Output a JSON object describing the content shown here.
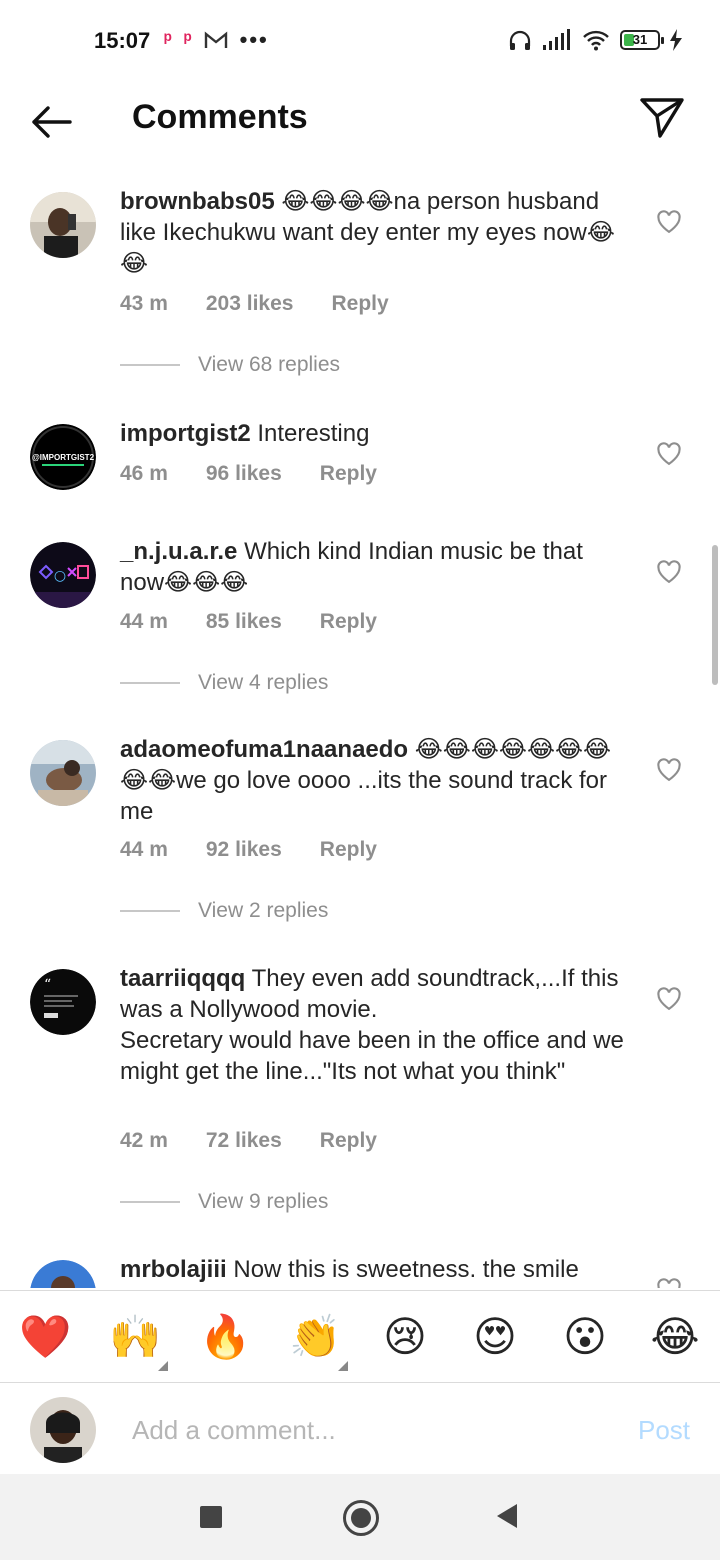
{
  "status": {
    "time": "15:07",
    "left_icons": [
      "p-app-icon",
      "p-app-icon",
      "gmail-icon",
      "more-dots-icon"
    ],
    "battery": "31",
    "battery_level_percent": 31,
    "right_icons": [
      "headphones-icon",
      "signal-icon",
      "wifi-icon",
      "battery-icon",
      "charging-icon"
    ]
  },
  "header": {
    "title": "Comments",
    "back_icon": "arrow-left-icon",
    "send_icon": "paper-plane-icon"
  },
  "comments": [
    {
      "username": "brownbabs05",
      "text": "😂😂😂😂na person husband like Ikechukwu want dey enter my eyes now😂😂",
      "time": "43 m",
      "likes": "203 likes",
      "reply": "Reply",
      "view_replies": "View 68 replies"
    },
    {
      "username": "importgist2",
      "text": "Interesting",
      "time": "46 m",
      "likes": "96 likes",
      "reply": "Reply",
      "avatar_text": "@IMPORTGIST2"
    },
    {
      "username": "_n.j.u.a.r.e",
      "text": "Which kind Indian music be that now😂😂😂",
      "time": "44 m",
      "likes": "85 likes",
      "reply": "Reply",
      "view_replies": "View 4 replies"
    },
    {
      "username": "adaomeofuma1naanaedo",
      "text": "😂😂😂😂😂😂😂😂😂we go love oooo ...its the sound track for me",
      "time": "44 m",
      "likes": "92 likes",
      "reply": "Reply",
      "view_replies": "View 2 replies"
    },
    {
      "username": "taarriiqqqq",
      "text": "They even add soundtrack,...If this was a Nollywood movie.\nSecretary would have been in the office  and we might get the line...\"Its not what you think\"",
      "time": "42 m",
      "likes": "72 likes",
      "reply": "Reply",
      "view_replies": "View 9 replies"
    },
    {
      "username": "mrbolajiii",
      "text": "Now this is sweetness.  the smile"
    }
  ],
  "reactions": [
    "❤️",
    "🙌",
    "🔥",
    "👏",
    "😢",
    "😍",
    "😮",
    "😂"
  ],
  "composer": {
    "placeholder": "Add a comment...",
    "post_label": "Post"
  },
  "colors": {
    "text": "#262626",
    "meta": "#8e8e8e",
    "post_disabled": "#b3dbff",
    "battery_green": "#3cb44a"
  }
}
